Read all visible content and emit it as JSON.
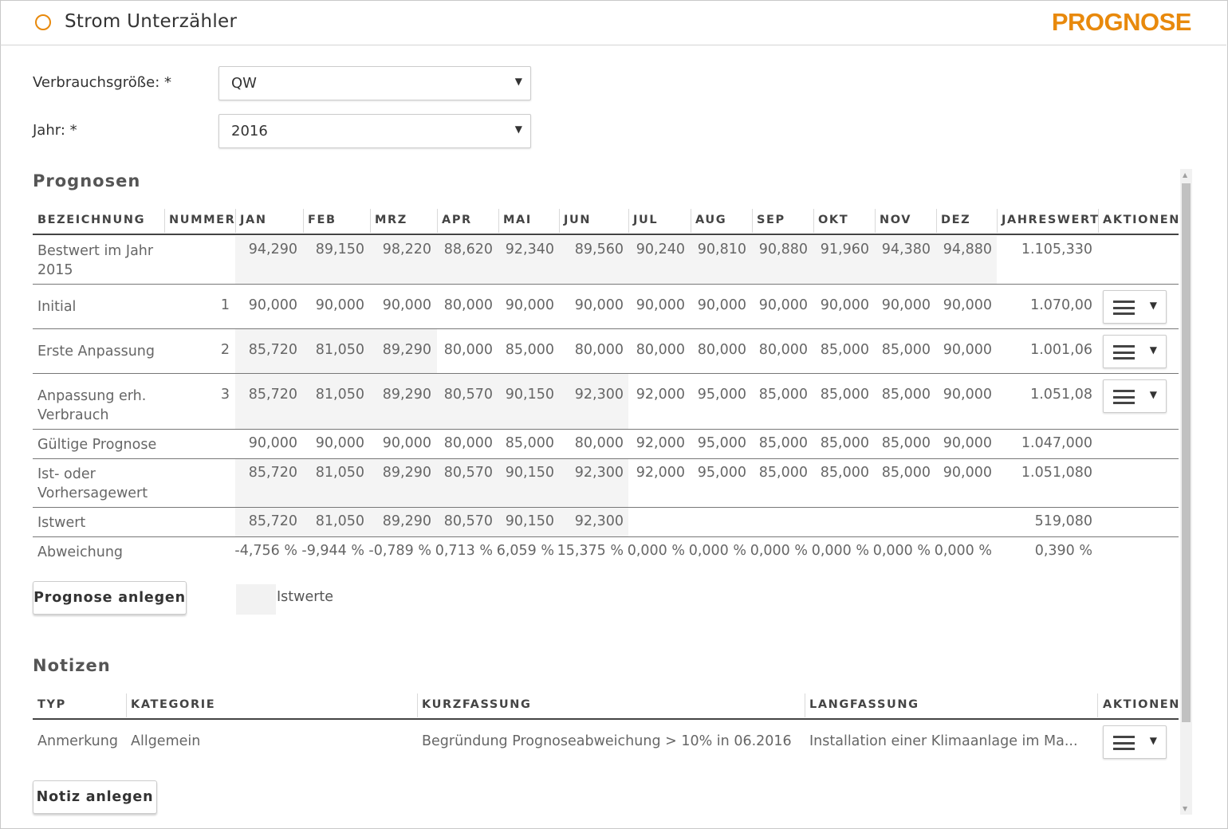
{
  "header": {
    "title": "Strom Unterzähler",
    "brand": "PROGNOSE",
    "accent": "#e8890c",
    "icon": "circle-icon"
  },
  "form": {
    "verbrauch_label": "Verbrauchsgröße: *",
    "verbrauch_value": "QW",
    "jahr_label": "Jahr: *",
    "jahr_value": "2016"
  },
  "prognosen": {
    "title": "Prognosen",
    "columns": [
      "BEZEICHNUNG",
      "NUMMER",
      "JAN",
      "FEB",
      "MRZ",
      "APR",
      "MAI",
      "JUN",
      "JUL",
      "AUG",
      "SEP",
      "OKT",
      "NOV",
      "DEZ",
      "JAHRESWERT",
      "AKTIONEN"
    ],
    "rows": [
      {
        "name": "Bestwert im Jahr 2015",
        "nummer": "",
        "months": [
          "94,290",
          "89,150",
          "98,220",
          "88,620",
          "92,340",
          "89,560",
          "90,240",
          "90,810",
          "90,880",
          "91,960",
          "94,380",
          "94,880"
        ],
        "total": "1.105,330",
        "action": false
      },
      {
        "name": "Initial",
        "nummer": "1",
        "months": [
          "90,000",
          "90,000",
          "90,000",
          "80,000",
          "90,000",
          "90,000",
          "90,000",
          "90,000",
          "90,000",
          "90,000",
          "90,000",
          "90,000"
        ],
        "total": "1.070,00",
        "action": true
      },
      {
        "name": "Erste Anpassung",
        "nummer": "2",
        "months": [
          "85,720",
          "81,050",
          "89,290",
          "80,000",
          "85,000",
          "80,000",
          "80,000",
          "80,000",
          "80,000",
          "85,000",
          "85,000",
          "90,000"
        ],
        "total": "1.001,06",
        "action": true
      },
      {
        "name": "Anpassung erh. Verbrauch",
        "nummer": "3",
        "months": [
          "85,720",
          "81,050",
          "89,290",
          "80,570",
          "90,150",
          "92,300",
          "92,000",
          "95,000",
          "85,000",
          "85,000",
          "85,000",
          "90,000"
        ],
        "total": "1.051,08",
        "action": true
      },
      {
        "name": "Gültige Prognose",
        "nummer": "",
        "months": [
          "90,000",
          "90,000",
          "90,000",
          "80,000",
          "85,000",
          "80,000",
          "92,000",
          "95,000",
          "85,000",
          "85,000",
          "85,000",
          "90,000"
        ],
        "total": "1.047,000",
        "action": false
      },
      {
        "name": "Ist- oder Vorhersagewert",
        "nummer": "",
        "months": [
          "85,720",
          "81,050",
          "89,290",
          "80,570",
          "90,150",
          "92,300",
          "92,000",
          "95,000",
          "85,000",
          "85,000",
          "85,000",
          "90,000"
        ],
        "total": "1.051,080",
        "action": false
      },
      {
        "name": "Istwert",
        "nummer": "",
        "months": [
          "85,720",
          "81,050",
          "89,290",
          "80,570",
          "90,150",
          "92,300",
          "",
          "",
          "",
          "",
          "",
          ""
        ],
        "total": "519,080",
        "action": false
      },
      {
        "name": "Abweichung",
        "nummer": "",
        "months": [
          "-4,756 %",
          "-9,944 %",
          "-0,789 %",
          "0,713 %",
          "6,059 %",
          "15,375 %",
          "0,000 %",
          "0,000 %",
          "0,000 %",
          "0,000 %",
          "0,000 %",
          "0,000 %"
        ],
        "total": "0,390 %",
        "action": false
      }
    ],
    "add_button": "Prognose anlegen",
    "legend": "Istwerte"
  },
  "notizen": {
    "title": "Notizen",
    "columns": [
      "TYP",
      "KATEGORIE",
      "KURZFASSUNG",
      "LANGFASSUNG",
      "AKTIONEN"
    ],
    "rows": [
      {
        "typ": "Anmerkung",
        "kategorie": "Allgemein",
        "kurz": "Begründung Prognoseabweichung > 10% in 06.2016",
        "lang": "Installation einer Klimaanlage im Ma..."
      }
    ],
    "add_button": "Notiz anlegen"
  },
  "colors": {
    "shade": "#f4f4f4",
    "text": "#666666",
    "heading": "#444444"
  }
}
